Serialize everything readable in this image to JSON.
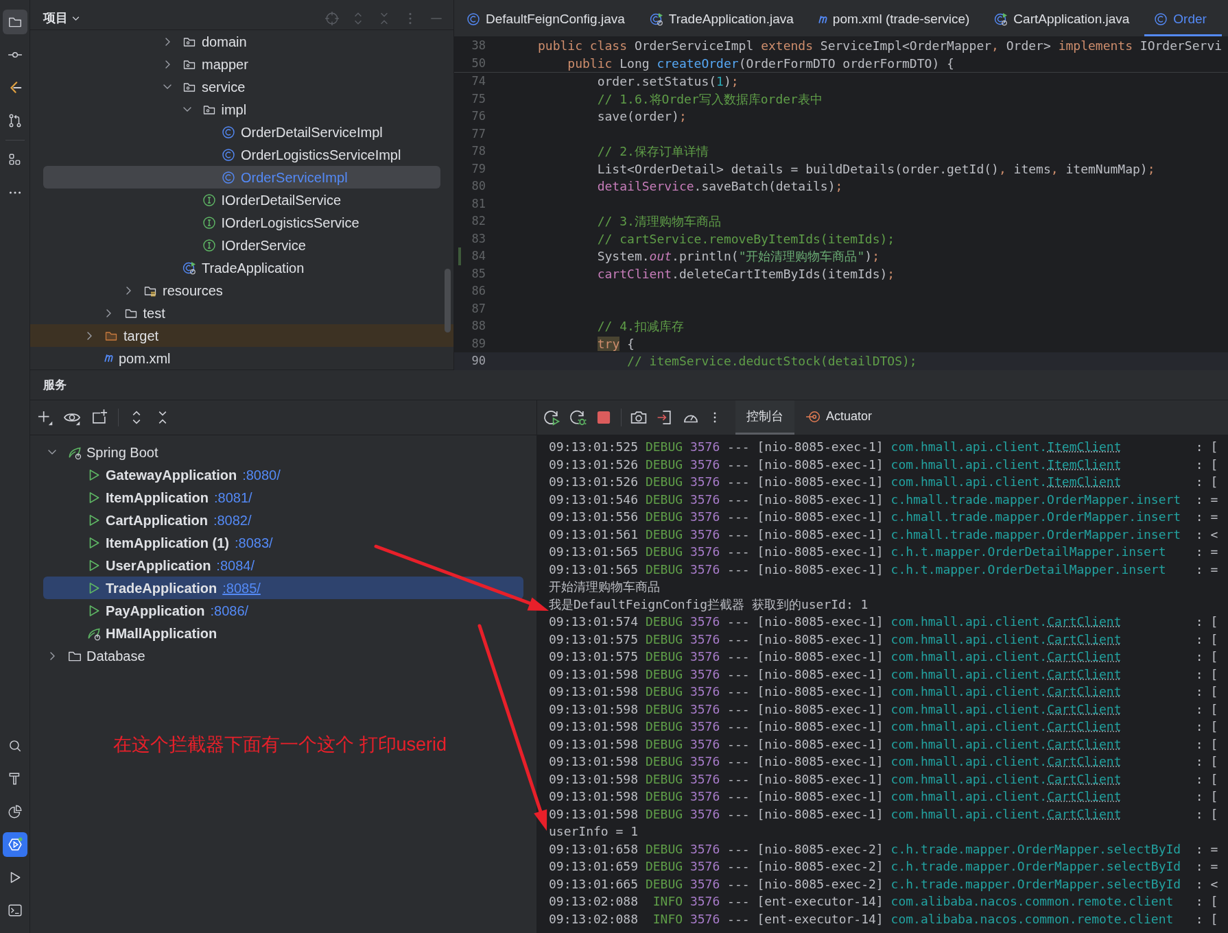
{
  "tool_strip": {
    "top": [
      {
        "kind": "folder",
        "selected": true
      },
      {
        "kind": "commit",
        "selected": false
      },
      {
        "kind": "code-logo",
        "selected": false
      },
      {
        "kind": "pull-request",
        "selected": false
      },
      {
        "kind": "structure",
        "selected": false
      },
      {
        "kind": "more",
        "selected": false
      }
    ],
    "bottom": [
      {
        "kind": "search",
        "selected": false
      },
      {
        "kind": "hammer",
        "selected": false
      },
      {
        "kind": "pie",
        "selected": false
      },
      {
        "kind": "services",
        "selected": true
      },
      {
        "kind": "run",
        "selected": false
      },
      {
        "kind": "terminal",
        "selected": false
      }
    ]
  },
  "project": {
    "title": "项目",
    "tree": [
      {
        "children": [
          {
            "children": [
              {
                "children": [
                  {
                    "children": [
                      {
                        "label": "domain",
                        "kind": "package",
                        "expanded": false,
                        "selected": false
                      },
                      {
                        "label": "mapper",
                        "kind": "package",
                        "expanded": false,
                        "selected": false
                      },
                      {
                        "label": "service",
                        "kind": "package",
                        "expanded": true,
                        "selected": false,
                        "children": [
                          {
                            "label": "impl",
                            "kind": "package",
                            "expanded": true,
                            "selected": false,
                            "children": [
                              {
                                "label": "OrderDetailServiceImpl",
                                "kind": "class",
                                "selected": false
                              },
                              {
                                "label": "OrderLogisticsServiceImpl",
                                "kind": "class",
                                "selected": false
                              },
                              {
                                "label": "OrderServiceImpl",
                                "kind": "class",
                                "selected": true
                              }
                            ]
                          },
                          {
                            "label": "IOrderDetailService",
                            "kind": "interface",
                            "selected": false
                          },
                          {
                            "label": "IOrderLogisticsService",
                            "kind": "interface",
                            "selected": false
                          },
                          {
                            "label": "IOrderService",
                            "kind": "interface",
                            "selected": false
                          }
                        ]
                      },
                      {
                        "label": "TradeApplication",
                        "kind": "app",
                        "selected": false
                      }
                    ]
                  }
                ]
              },
              {
                "label": "resources",
                "kind": "resources",
                "expanded": false,
                "selected": false
              }
            ]
          },
          {
            "label": "test",
            "kind": "folder",
            "expanded": false,
            "selected": false
          }
        ]
      },
      {
        "label": "target",
        "kind": "excluded-folder",
        "expanded": false,
        "selected": false
      },
      {
        "label": "pom.xml",
        "kind": "maven",
        "selected": false
      }
    ]
  },
  "editor": {
    "tabs": [
      {
        "label": "DefaultFeignConfig.java",
        "kind": "class",
        "selected": false
      },
      {
        "label": "TradeApplication.java",
        "kind": "app",
        "selected": false
      },
      {
        "label": "pom.xml (trade-service)",
        "kind": "maven",
        "selected": false
      },
      {
        "label": "CartApplication.java",
        "kind": "app",
        "selected": false
      },
      {
        "label": "Order",
        "kind": "class",
        "selected": true
      }
    ],
    "sticky_lines": [
      {
        "number": "38",
        "tokens": [
          {
            "kind": "keyword",
            "text": "public class "
          },
          {
            "kind": "plain",
            "text": "OrderServiceImpl "
          },
          {
            "kind": "keyword",
            "text": "extends "
          },
          {
            "kind": "plain",
            "text": "ServiceImpl<OrderMapper"
          },
          {
            "kind": "punct",
            "text": ", "
          },
          {
            "kind": "plain",
            "text": "Order> "
          },
          {
            "kind": "keyword",
            "text": "implements "
          },
          {
            "kind": "plain",
            "text": "IOrderServi"
          }
        ]
      },
      {
        "number": "50",
        "tokens": [
          {
            "kind": "keyword",
            "text": "    public "
          },
          {
            "kind": "plain",
            "text": "Long "
          },
          {
            "kind": "method",
            "text": "createOrder"
          },
          {
            "kind": "plain",
            "text": "(OrderFormDTO orderFormDTO) {"
          }
        ]
      }
    ],
    "lines": [
      {
        "number": "74",
        "current": false,
        "modified": false,
        "tokens": [
          {
            "kind": "plain",
            "text": "        order.setStatus("
          },
          {
            "kind": "number",
            "text": "1"
          },
          {
            "kind": "plain",
            "text": ")"
          },
          {
            "kind": "punct",
            "text": ";"
          }
        ]
      },
      {
        "number": "75",
        "current": false,
        "modified": false,
        "tokens": [
          {
            "kind": "comment",
            "text": "        // 1.6.将Order写入数据库order表中"
          }
        ]
      },
      {
        "number": "76",
        "current": false,
        "modified": false,
        "tokens": [
          {
            "kind": "plain",
            "text": "        save(order)"
          },
          {
            "kind": "punct",
            "text": ";"
          }
        ]
      },
      {
        "number": "77",
        "current": false,
        "modified": false
      },
      {
        "number": "78",
        "current": false,
        "modified": false,
        "tokens": [
          {
            "kind": "comment",
            "text": "        // 2.保存订单详情"
          }
        ]
      },
      {
        "number": "79",
        "current": false,
        "modified": false,
        "tokens": [
          {
            "kind": "plain",
            "text": "        List<OrderDetail> details = buildDetails(order.getId()"
          },
          {
            "kind": "punct",
            "text": ", "
          },
          {
            "kind": "plain",
            "text": "items"
          },
          {
            "kind": "punct",
            "text": ", "
          },
          {
            "kind": "plain",
            "text": "itemNumMap)"
          },
          {
            "kind": "punct",
            "text": ";"
          }
        ]
      },
      {
        "number": "80",
        "current": false,
        "modified": false,
        "tokens": [
          {
            "kind": "field",
            "text": "        detailService"
          },
          {
            "kind": "plain",
            "text": ".saveBatch(details)"
          },
          {
            "kind": "punct",
            "text": ";"
          }
        ]
      },
      {
        "number": "81",
        "current": false,
        "modified": false
      },
      {
        "number": "82",
        "current": false,
        "modified": false,
        "tokens": [
          {
            "kind": "comment",
            "text": "        // 3.清理购物车商品"
          }
        ]
      },
      {
        "number": "83",
        "current": false,
        "modified": false,
        "tokens": [
          {
            "kind": "comment",
            "text": "        // cartService.removeByItemIds(itemIds);"
          }
        ]
      },
      {
        "number": "84",
        "current": false,
        "modified": true,
        "tokens": [
          {
            "kind": "plain",
            "text": "        System."
          },
          {
            "kind": "static-field",
            "text": "out"
          },
          {
            "kind": "plain",
            "text": ".println("
          },
          {
            "kind": "string",
            "text": "\"开始清理购物车商品\""
          },
          {
            "kind": "plain",
            "text": ")"
          },
          {
            "kind": "punct",
            "text": ";"
          }
        ]
      },
      {
        "number": "85",
        "current": false,
        "modified": false,
        "tokens": [
          {
            "kind": "field",
            "text": "        cartClient"
          },
          {
            "kind": "plain",
            "text": ".deleteCartItemByIds(itemIds)"
          },
          {
            "kind": "punct",
            "text": ";"
          }
        ]
      },
      {
        "number": "86",
        "current": false,
        "modified": false
      },
      {
        "number": "87",
        "current": false,
        "modified": false
      },
      {
        "number": "88",
        "current": false,
        "modified": false,
        "tokens": [
          {
            "kind": "comment",
            "text": "        // 4.扣减库存"
          }
        ]
      },
      {
        "number": "89",
        "current": false,
        "modified": false,
        "tokens": [
          {
            "kind": "keyword-match",
            "text": "        try"
          },
          {
            "kind": "plain",
            "text": " {"
          }
        ]
      },
      {
        "number": "90",
        "current": true,
        "modified": false,
        "tokens": [
          {
            "kind": "comment",
            "text": "            // itemService.deductStock(detailDTOS);"
          }
        ]
      }
    ]
  },
  "services": {
    "title": "服务",
    "tree": [
      {
        "label": "Spring Boot",
        "kind": "spring-group",
        "expanded": true,
        "selected": false,
        "children": [
          {
            "label": "GatewayApplication",
            "port": ":8080/",
            "kind": "app",
            "selected": false
          },
          {
            "label": "ItemApplication",
            "port": ":8081/",
            "kind": "app",
            "selected": false
          },
          {
            "label": "CartApplication",
            "port": ":8082/",
            "kind": "app",
            "selected": false
          },
          {
            "label": "ItemApplication (1)",
            "port": ":8083/",
            "kind": "app",
            "selected": false
          },
          {
            "label": "UserApplication",
            "port": ":8084/",
            "kind": "app",
            "selected": false
          },
          {
            "label": "TradeApplication",
            "port": ":8085/",
            "kind": "app",
            "selected": true
          },
          {
            "label": "PayApplication",
            "port": ":8086/",
            "kind": "app",
            "selected": false
          },
          {
            "label": "HMallApplication",
            "kind": "spring-config",
            "selected": false
          }
        ]
      },
      {
        "label": "Database",
        "kind": "folder",
        "expanded": false,
        "selected": false
      }
    ]
  },
  "console": {
    "tabs": [
      {
        "label": "控制台",
        "kind": "plain",
        "selected": true
      },
      {
        "label": "Actuator",
        "kind": "actuator",
        "selected": false
      }
    ],
    "lines": [
      {
        "kind": "log",
        "time": "09:13:01:525",
        "level": "DEBUG",
        "pid": "3576",
        "sep": "---",
        "thread": "[nio-8085-exec-1]",
        "logger": "com.hmall.api.client.",
        "link": "ItemClient",
        "tail": ": ["
      },
      {
        "kind": "log",
        "time": "09:13:01:526",
        "level": "DEBUG",
        "pid": "3576",
        "sep": "---",
        "thread": "[nio-8085-exec-1]",
        "logger": "com.hmall.api.client.",
        "link": "ItemClient",
        "tail": ": ["
      },
      {
        "kind": "log",
        "time": "09:13:01:526",
        "level": "DEBUG",
        "pid": "3576",
        "sep": "---",
        "thread": "[nio-8085-exec-1]",
        "logger": "com.hmall.api.client.",
        "link": "ItemClient",
        "tail": ": ["
      },
      {
        "kind": "log",
        "time": "09:13:01:546",
        "level": "DEBUG",
        "pid": "3576",
        "sep": "---",
        "thread": "[nio-8085-exec-1]",
        "logger": "c.hmall.trade.mapper.OrderMapper.insert",
        "tail": ": ="
      },
      {
        "kind": "log",
        "time": "09:13:01:556",
        "level": "DEBUG",
        "pid": "3576",
        "sep": "---",
        "thread": "[nio-8085-exec-1]",
        "logger": "c.hmall.trade.mapper.OrderMapper.insert",
        "tail": ": ="
      },
      {
        "kind": "log",
        "time": "09:13:01:561",
        "level": "DEBUG",
        "pid": "3576",
        "sep": "---",
        "thread": "[nio-8085-exec-1]",
        "logger": "c.hmall.trade.mapper.OrderMapper.insert",
        "tail": ": <"
      },
      {
        "kind": "log",
        "time": "09:13:01:565",
        "level": "DEBUG",
        "pid": "3576",
        "sep": "---",
        "thread": "[nio-8085-exec-1]",
        "logger": "c.h.t.mapper.OrderDetailMapper.insert",
        "tail": ": ="
      },
      {
        "kind": "log",
        "time": "09:13:01:565",
        "level": "DEBUG",
        "pid": "3576",
        "sep": "---",
        "thread": "[nio-8085-exec-1]",
        "logger": "c.h.t.mapper.OrderDetailMapper.insert",
        "tail": ": ="
      },
      {
        "kind": "text",
        "text": "开始清理购物车商品"
      },
      {
        "kind": "text",
        "text": "我是DefaultFeignConfig拦截器 获取到的userId: 1"
      },
      {
        "kind": "log",
        "time": "09:13:01:574",
        "level": "DEBUG",
        "pid": "3576",
        "sep": "---",
        "thread": "[nio-8085-exec-1]",
        "logger": "com.hmall.api.client.",
        "link": "CartClient",
        "tail": ": ["
      },
      {
        "kind": "log",
        "time": "09:13:01:575",
        "level": "DEBUG",
        "pid": "3576",
        "sep": "---",
        "thread": "[nio-8085-exec-1]",
        "logger": "com.hmall.api.client.",
        "link": "CartClient",
        "tail": ": ["
      },
      {
        "kind": "log",
        "time": "09:13:01:575",
        "level": "DEBUG",
        "pid": "3576",
        "sep": "---",
        "thread": "[nio-8085-exec-1]",
        "logger": "com.hmall.api.client.",
        "link": "CartClient",
        "tail": ": ["
      },
      {
        "kind": "log",
        "time": "09:13:01:598",
        "level": "DEBUG",
        "pid": "3576",
        "sep": "---",
        "thread": "[nio-8085-exec-1]",
        "logger": "com.hmall.api.client.",
        "link": "CartClient",
        "tail": ": ["
      },
      {
        "kind": "log",
        "time": "09:13:01:598",
        "level": "DEBUG",
        "pid": "3576",
        "sep": "---",
        "thread": "[nio-8085-exec-1]",
        "logger": "com.hmall.api.client.",
        "link": "CartClient",
        "tail": ": ["
      },
      {
        "kind": "log",
        "time": "09:13:01:598",
        "level": "DEBUG",
        "pid": "3576",
        "sep": "---",
        "thread": "[nio-8085-exec-1]",
        "logger": "com.hmall.api.client.",
        "link": "CartClient",
        "tail": ": ["
      },
      {
        "kind": "log",
        "time": "09:13:01:598",
        "level": "DEBUG",
        "pid": "3576",
        "sep": "---",
        "thread": "[nio-8085-exec-1]",
        "logger": "com.hmall.api.client.",
        "link": "CartClient",
        "tail": ": ["
      },
      {
        "kind": "log",
        "time": "09:13:01:598",
        "level": "DEBUG",
        "pid": "3576",
        "sep": "---",
        "thread": "[nio-8085-exec-1]",
        "logger": "com.hmall.api.client.",
        "link": "CartClient",
        "tail": ": ["
      },
      {
        "kind": "log",
        "time": "09:13:01:598",
        "level": "DEBUG",
        "pid": "3576",
        "sep": "---",
        "thread": "[nio-8085-exec-1]",
        "logger": "com.hmall.api.client.",
        "link": "CartClient",
        "tail": ": ["
      },
      {
        "kind": "log",
        "time": "09:13:01:598",
        "level": "DEBUG",
        "pid": "3576",
        "sep": "---",
        "thread": "[nio-8085-exec-1]",
        "logger": "com.hmall.api.client.",
        "link": "CartClient",
        "tail": ": ["
      },
      {
        "kind": "log",
        "time": "09:13:01:598",
        "level": "DEBUG",
        "pid": "3576",
        "sep": "---",
        "thread": "[nio-8085-exec-1]",
        "logger": "com.hmall.api.client.",
        "link": "CartClient",
        "tail": ": ["
      },
      {
        "kind": "log",
        "time": "09:13:01:598",
        "level": "DEBUG",
        "pid": "3576",
        "sep": "---",
        "thread": "[nio-8085-exec-1]",
        "logger": "com.hmall.api.client.",
        "link": "CartClient",
        "tail": ": ["
      },
      {
        "kind": "text",
        "text": "userInfo = 1"
      },
      {
        "kind": "log",
        "time": "09:13:01:658",
        "level": "DEBUG",
        "pid": "3576",
        "sep": "---",
        "thread": "[nio-8085-exec-2]",
        "logger": "c.h.trade.mapper.OrderMapper.selectById",
        "tail": ": ="
      },
      {
        "kind": "log",
        "time": "09:13:01:659",
        "level": "DEBUG",
        "pid": "3576",
        "sep": "---",
        "thread": "[nio-8085-exec-2]",
        "logger": "c.h.trade.mapper.OrderMapper.selectById",
        "tail": ": ="
      },
      {
        "kind": "log",
        "time": "09:13:01:665",
        "level": "DEBUG",
        "pid": "3576",
        "sep": "---",
        "thread": "[nio-8085-exec-2]",
        "logger": "c.h.trade.mapper.OrderMapper.selectById",
        "tail": ": <"
      },
      {
        "kind": "log",
        "time": "09:13:02:088",
        "level": "INFO",
        "pid": "3576",
        "sep": "---",
        "thread": "[ent-executor-14]",
        "logger": "com.alibaba.nacos.common.remote.client",
        "tail": ": ["
      },
      {
        "kind": "log",
        "time": "09:13:02:088",
        "level": "INFO",
        "pid": "3576",
        "sep": "---",
        "thread": "[ent-executor-14]",
        "logger": "com.alibaba.nacos.common.remote.client",
        "tail": ": ["
      }
    ]
  },
  "annotation": {
    "text": "在这个拦截器下面有一个这个 打印userid"
  }
}
